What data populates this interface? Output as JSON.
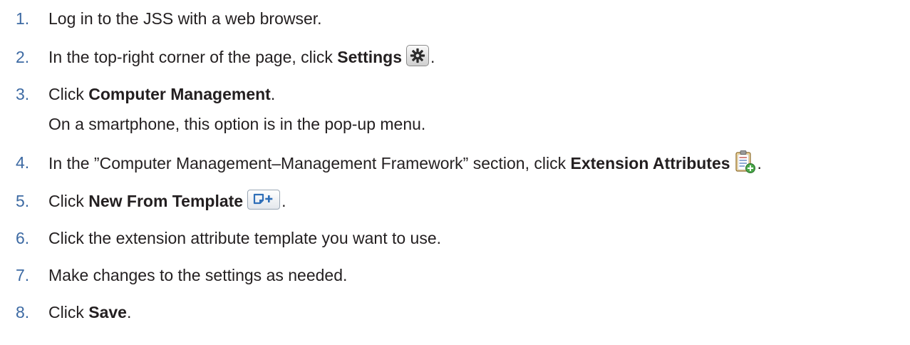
{
  "steps": [
    {
      "num": "1.",
      "before": "Log in to the JSS with a web browser.",
      "bold": "",
      "after": ""
    },
    {
      "num": "2.",
      "before": "In the top-right corner of the page, click ",
      "bold": "Settings",
      "after": "."
    },
    {
      "num": "3.",
      "before": "Click ",
      "bold": "Computer Management",
      "after": ".",
      "note": "On a smartphone, this option is in the pop-up menu."
    },
    {
      "num": "4.",
      "before": "In the ”Computer Management–Management Framework” section, click ",
      "bold": "Extension Attributes",
      "after": "."
    },
    {
      "num": "5.",
      "before": "Click ",
      "bold": "New From Template",
      "after": "."
    },
    {
      "num": "6.",
      "before": "Click the extension attribute template you want to use.",
      "bold": "",
      "after": ""
    },
    {
      "num": "7.",
      "before": "Make changes to the settings as needed.",
      "bold": "",
      "after": ""
    },
    {
      "num": "8.",
      "before": "Click ",
      "bold": "Save",
      "after": "."
    }
  ],
  "icons": {
    "settings": "gear-icon",
    "extension_attributes": "clipboard-add-icon",
    "new_from_template": "template-add-icon"
  },
  "colors": {
    "step_number": "#3d6aa3",
    "body_text": "#231f20"
  }
}
